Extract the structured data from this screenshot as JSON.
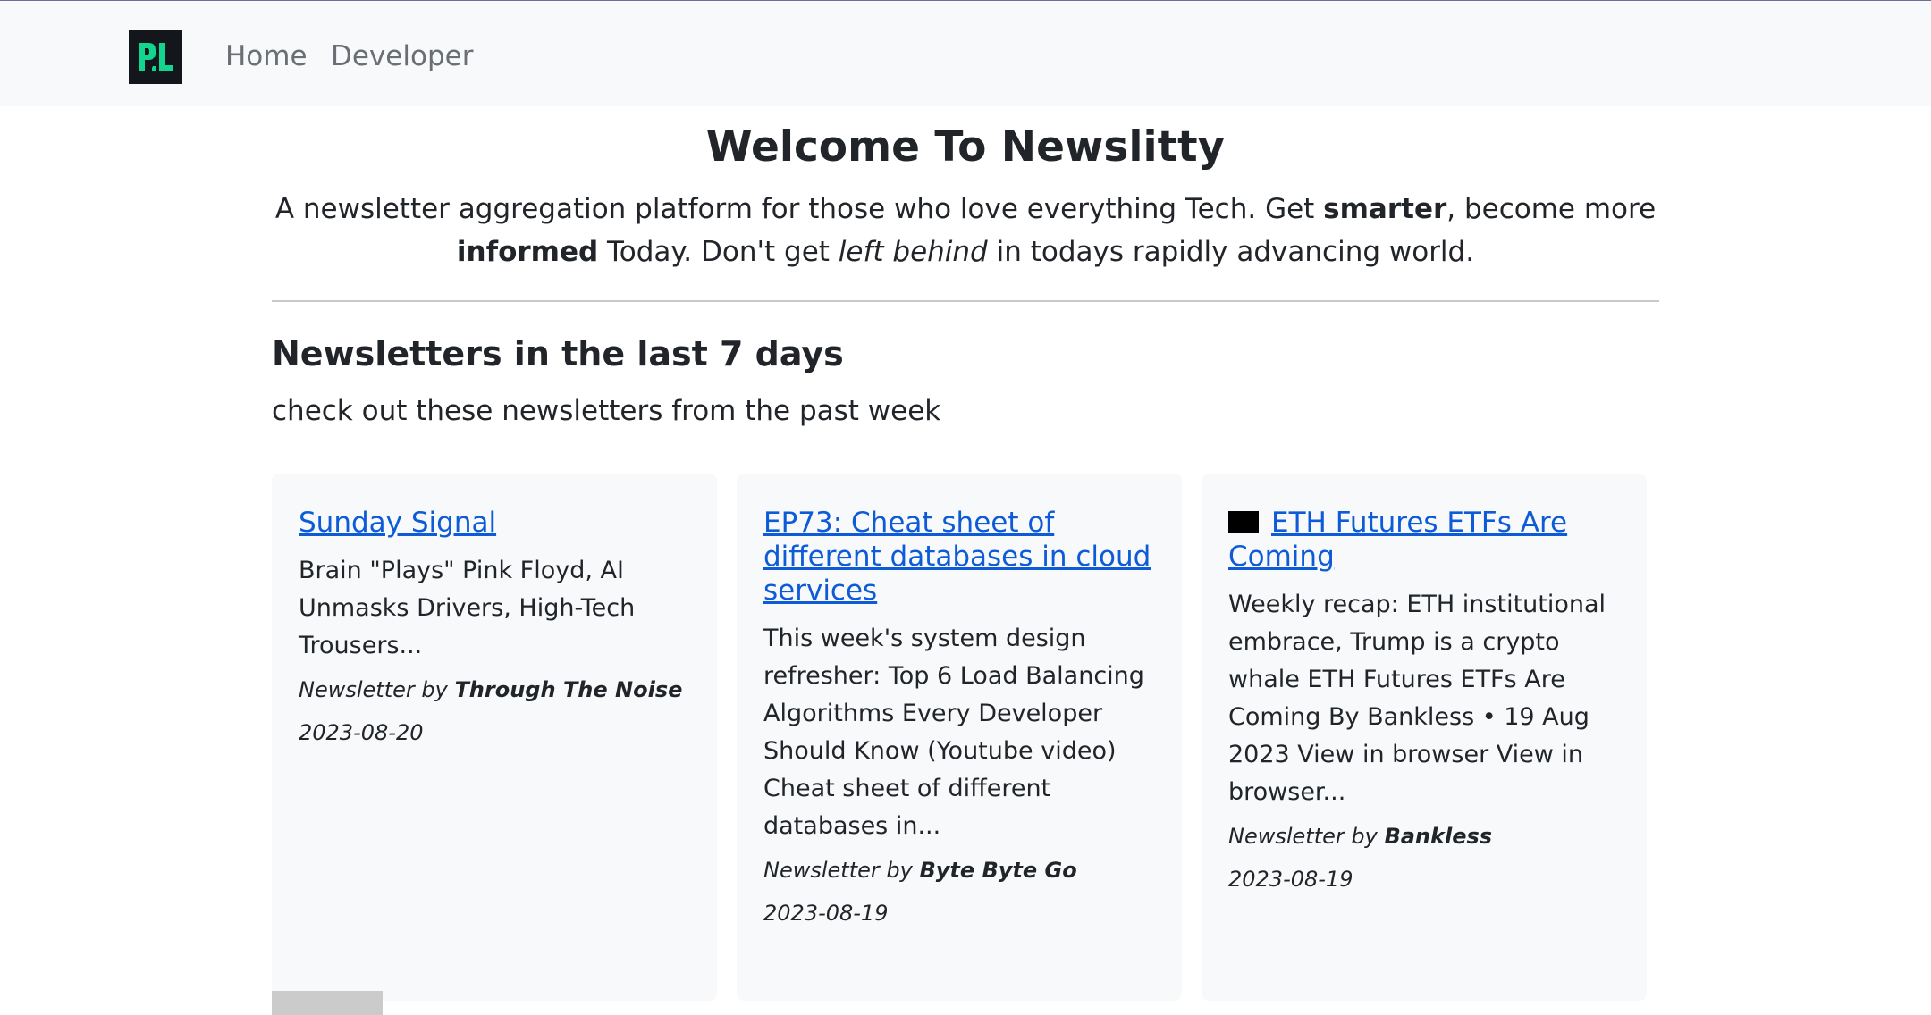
{
  "colors": {
    "navbar_bg": "#f8f9fa",
    "logo_bg": "#13171c",
    "logo_accent": "#12d68f",
    "link": "#0d5bd7",
    "card_bg": "#f8f9fa"
  },
  "nav": {
    "logo_icon": "newslitty-logo",
    "links": [
      {
        "label": "Home"
      },
      {
        "label": "Developer"
      }
    ]
  },
  "hero": {
    "title": "Welcome To Newslitty",
    "lead_part1": "A newsletter aggregation platform for those who love everything Tech. Get ",
    "lead_bold1": "smarter",
    "lead_part2": ", become more ",
    "lead_bold2": "informed",
    "lead_part3": " Today. Don't get ",
    "lead_italic": "left behind",
    "lead_part4": " in todays rapidly advancing world."
  },
  "section": {
    "title": "Newsletters in the last 7 days",
    "subtitle": "check out these newsletters from the past week"
  },
  "cards": [
    {
      "title": "Sunday Signal",
      "summary": "Brain \"Plays\" Pink Floyd, AI Unmasks Drivers, High-Tech Trousers...",
      "by_label": "Newsletter by ",
      "source": "Through The Noise",
      "date": "2023-08-20"
    },
    {
      "title": "EP73: Cheat sheet of different databases in cloud services",
      "summary": "This week's system design refresher: Top 6 Load Balancing Algorithms Every Developer Should Know (Youtube video) Cheat sheet of different databases in...",
      "by_label": "Newsletter by ",
      "source": "Byte Byte Go",
      "date": "2023-08-19"
    },
    {
      "title_icon": "black-square-icon",
      "title": "ETH Futures ETFs Are Coming",
      "summary": "Weekly recap: ETH institutional embrace, Trump is a crypto whale ETH Futures ETFs Are Coming By Bankless • 19 Aug 2023 View in browser View in browser...",
      "by_label": "Newsletter by ",
      "source": "Bankless",
      "date": "2023-08-19"
    }
  ]
}
